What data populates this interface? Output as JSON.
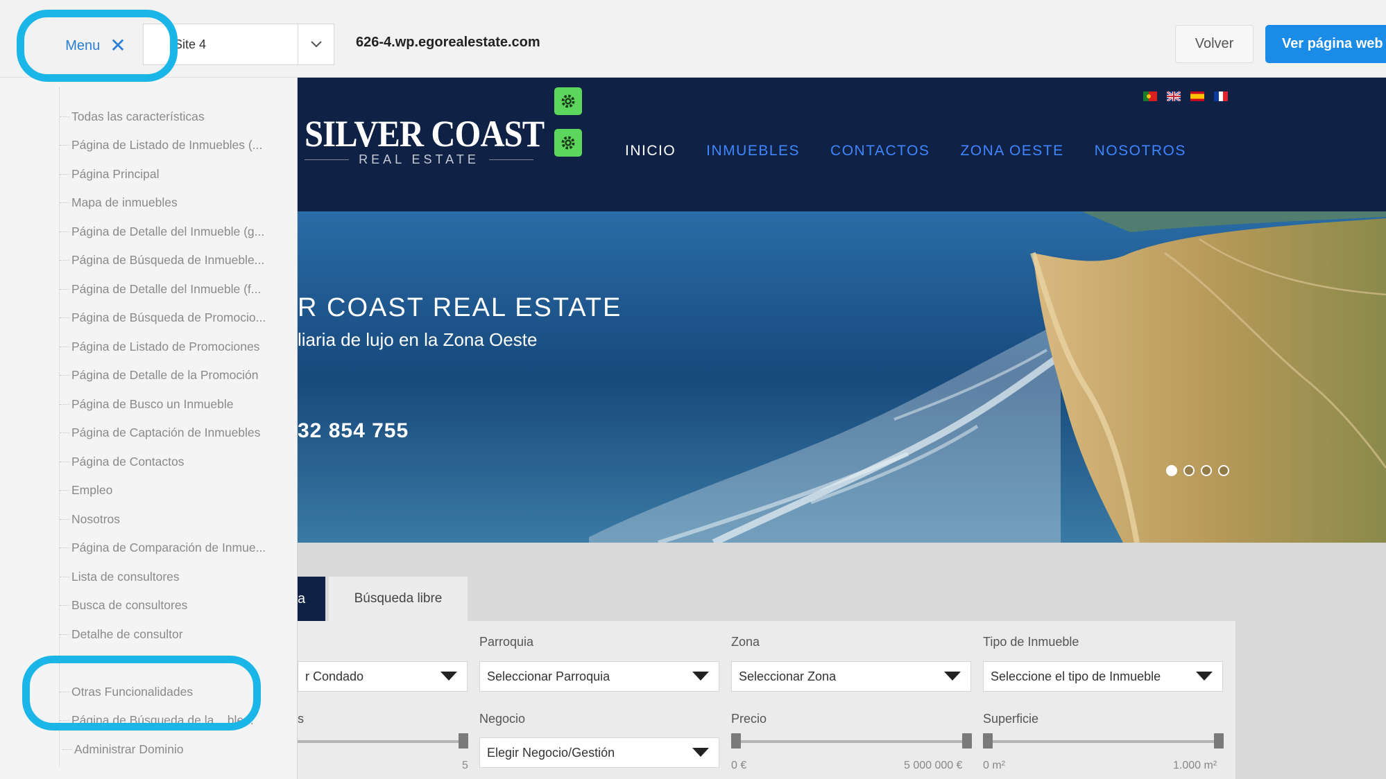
{
  "topbar": {
    "menu_label": "Menu",
    "site_select_value": "Site 4",
    "domain": "626-4.wp.egorealestate.com",
    "back_label": "Volver",
    "view_site_label": "Ver página web"
  },
  "sidebar": {
    "items": [
      "Todas las características",
      "Página de Listado de Inmuebles (...",
      "Página Principal",
      "Mapa de inmuebles",
      "Página de Detalle del Inmueble (g...",
      "Página de Búsqueda de Inmueble...",
      "Página de Detalle del Inmueble (f...",
      "Página de Búsqueda de Promocio...",
      "Página de Listado de Promociones",
      "Página de Detalle de la Promoción",
      "Página de Busco un Inmueble",
      "Página de Captación de Inmuebles",
      "Página de Contactos",
      "Empleo",
      "Nosotros",
      "Página de Comparación de Inmue...",
      "Lista de consultores",
      "Busca de consultores",
      "Detalhe de consultor",
      "Otras Funcionalidades",
      "Página de Búsqueda de la ...ble...",
      "Administrar Dominio"
    ]
  },
  "site": {
    "logo_main": "SILVER COAST",
    "logo_sub": "REAL ESTATE",
    "nav": [
      "INICIO",
      "INMUEBLES",
      "CONTACTOS",
      "ZONA OESTE",
      "NOSOTROS"
    ],
    "flags": [
      "Portugal",
      "United Kingdom",
      "Spain",
      "France"
    ],
    "hero_title": "R COAST REAL ESTATE",
    "hero_subtitle": "liaria de lujo en la Zona Oeste",
    "hero_phone": "32 854 755",
    "tab_active_fragment": "a",
    "tab_free_search": "Búsqueda libre",
    "search": {
      "county_value": "r Condado",
      "parish_label": "Parroquia",
      "parish_value": "Seleccionar Parroquia",
      "zone_label": "Zona",
      "zone_value": "Seleccionar Zona",
      "type_label": "Tipo de Inmueble",
      "type_value": "Seleccione el tipo de Inmueble",
      "rooms_label_fragment": "s",
      "rooms_max": "5",
      "business_label": "Negocio",
      "business_value": "Elegir Negocio/Gestión",
      "price_label": "Precio",
      "price_min": "0 €",
      "price_max": "5 000 000 €",
      "area_label": "Superficie",
      "area_min": "0 m²",
      "area_max": "1.000 m²"
    }
  },
  "colors": {
    "highlight": "#1bb6e8",
    "accent_blue": "#1a8be6",
    "site_navy": "#0f2144",
    "gear_green": "#5cd65c",
    "nav_link": "#3f86ff"
  }
}
